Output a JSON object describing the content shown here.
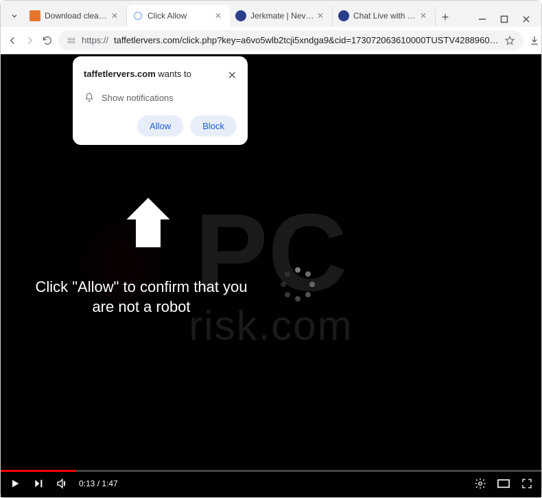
{
  "titlebar": {
    "tab_dropdown": "⌄"
  },
  "tabs": [
    {
      "title": "Download clean Tor",
      "favicon": "#E8742C",
      "active": false
    },
    {
      "title": "Click Allow",
      "favicon": "#8ab4f8",
      "active": true
    },
    {
      "title": "Jerkmate | Never je",
      "favicon": "#2c3e8a",
      "active": false
    },
    {
      "title": "Chat Live with Hot C",
      "favicon": "#2c3e8a",
      "active": false
    }
  ],
  "addr": {
    "url_prefix": "https://",
    "url": "taffetlervers.com/click.php?key=a6vo5wlb2tcji5xndga9&cid=173072063610000TUSTV4288960…"
  },
  "permission": {
    "site": "taffetlervers.com",
    "wants_to": "wants to",
    "item": "Show notifications",
    "allow": "Allow",
    "block": "Block"
  },
  "scam_text": "Click \"Allow\" to confirm that you are not a robot",
  "video": {
    "elapsed": "0:13",
    "total": "1:47",
    "progress_percent": 14
  },
  "watermark": {
    "top": "PC",
    "bottom": "risk.com"
  }
}
